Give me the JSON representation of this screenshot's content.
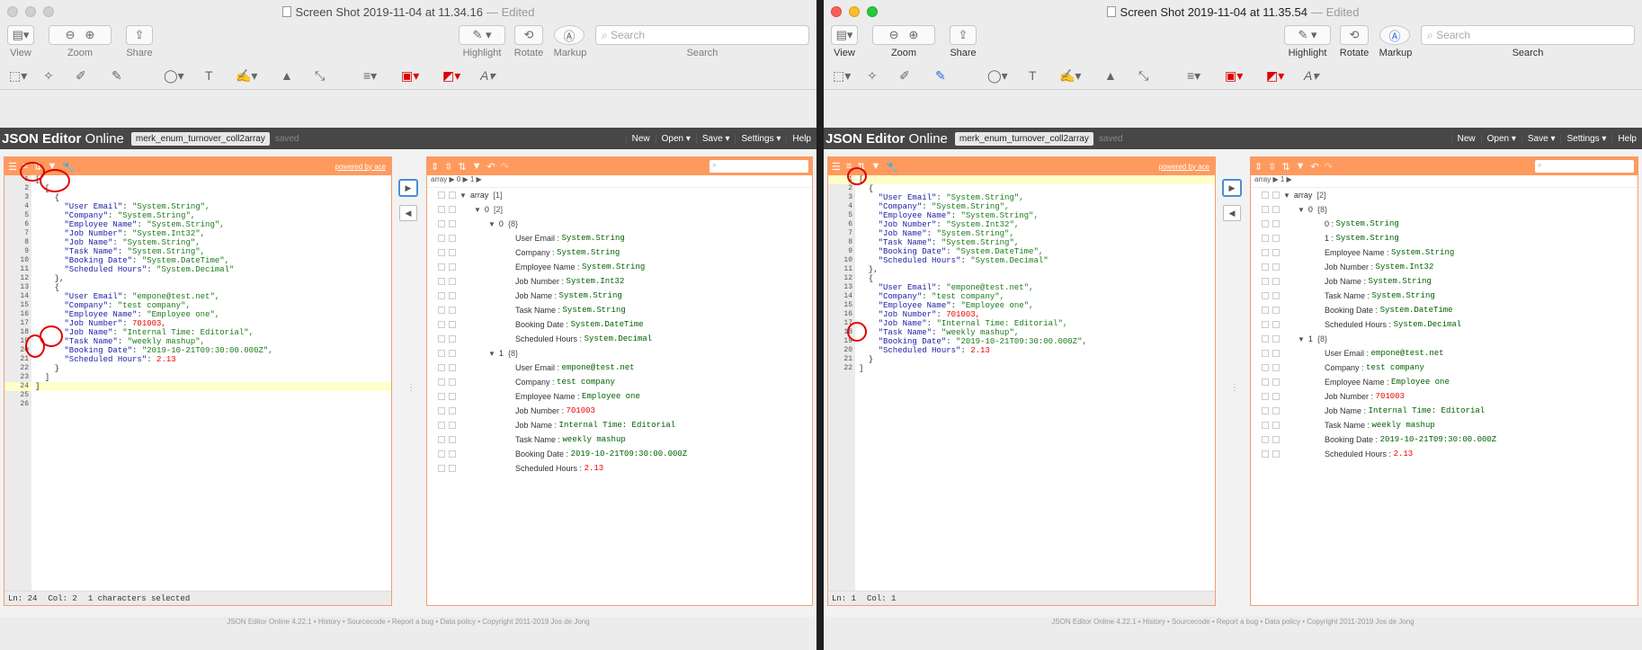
{
  "left": {
    "title": "Screen Shot 2019-11-04 at 11.34.16",
    "edited": "— Edited",
    "toolbar": {
      "view": "View",
      "zoom": "Zoom",
      "share": "Share",
      "highlight": "Highlight",
      "rotate": "Rotate",
      "markup": "Markup",
      "search_placeholder": "Search",
      "search_label": "Search"
    },
    "app": {
      "logo_bold": "JSON Editor",
      "logo_light": " Online",
      "filename": "merk_enum_turnover_coll2array",
      "saved": "saved",
      "menu": [
        "New",
        "Open ▾",
        "Save ▾",
        "Settings ▾",
        "Help"
      ],
      "powered": "powered by ace"
    },
    "code_lines": [
      "[",
      "  [",
      "    {",
      "      \"User Email\": \"System.String\",",
      "      \"Company\": \"System.String\",",
      "      \"Employee Name\": \"System.String\",",
      "      \"Job Number\": \"System.Int32\",",
      "      \"Job Name\": \"System.String\",",
      "      \"Task Name\": \"System.String\",",
      "      \"Booking Date\": \"System.DateTime\",",
      "      \"Scheduled Hours\": \"System.Decimal\"",
      "    },",
      "    {",
      "      \"User Email\": \"empone@test.net\",",
      "      \"Company\": \"test company\",",
      "      \"Employee Name\": \"Employee one\",",
      "      \"Job Number\": 701003,",
      "      \"Job Name\": \"Internal Time: Editorial\",",
      "      \"Task Name\": \"weekly mashup\",",
      "      \"Booking Date\": \"2019-10-21T09:30:00.000Z\",",
      "      \"Scheduled Hours\": 2.13",
      "    }",
      "  ]",
      "]",
      "",
      ""
    ],
    "status": {
      "ln": "Ln: 24",
      "col": "Col: 2",
      "sel": "1 characters selected"
    },
    "crumb": "array ▶ 0 ▶ 1 ▶",
    "tree": [
      {
        "indent": 0,
        "arrow": "▼",
        "key": "array",
        "count": "[1]"
      },
      {
        "indent": 1,
        "arrow": "▼",
        "key": "0",
        "count": "[2]"
      },
      {
        "indent": 2,
        "arrow": "▼",
        "key": "0",
        "count": "{8}"
      },
      {
        "indent": 3,
        "key": "User Email",
        "val": "System.String"
      },
      {
        "indent": 3,
        "key": "Company",
        "val": "System.String"
      },
      {
        "indent": 3,
        "key": "Employee Name",
        "val": "System.String"
      },
      {
        "indent": 3,
        "key": "Job Number",
        "val": "System.Int32"
      },
      {
        "indent": 3,
        "key": "Job Name",
        "val": "System.String"
      },
      {
        "indent": 3,
        "key": "Task Name",
        "val": "System.String"
      },
      {
        "indent": 3,
        "key": "Booking Date",
        "val": "System.DateTime"
      },
      {
        "indent": 3,
        "key": "Scheduled Hours",
        "val": "System.Decimal"
      },
      {
        "indent": 2,
        "arrow": "▼",
        "key": "1",
        "count": "{8}"
      },
      {
        "indent": 3,
        "key": "User Email",
        "val": "empone@test.net"
      },
      {
        "indent": 3,
        "key": "Company",
        "val": "test company"
      },
      {
        "indent": 3,
        "key": "Employee Name",
        "val": "Employee one"
      },
      {
        "indent": 3,
        "key": "Job Number",
        "num": "701003"
      },
      {
        "indent": 3,
        "key": "Job Name",
        "val": "Internal Time: Editorial"
      },
      {
        "indent": 3,
        "key": "Task Name",
        "val": "weekly mashup"
      },
      {
        "indent": 3,
        "key": "Booking Date",
        "val": "2019-10-21T09:30:00.000Z"
      },
      {
        "indent": 3,
        "key": "Scheduled Hours",
        "num": "2.13"
      }
    ],
    "footer": "JSON Editor Online 4.22.1 • History • Sourcecode • Report a bug • Data policy • Copyright 2011-2019 Jos de Jong"
  },
  "right": {
    "title": "Screen Shot 2019-11-04 at 11.35.54",
    "edited": "— Edited",
    "code_lines": [
      "[",
      "  {",
      "    \"User Email\": \"System.String\",",
      "    \"Company\": \"System.String\",",
      "    \"Employee Name\": \"System.String\",",
      "    \"Job Number\": \"System.Int32\",",
      "    \"Job Name\": \"System.String\",",
      "    \"Task Name\": \"System.String\",",
      "    \"Booking Date\": \"System.DateTime\",",
      "    \"Scheduled Hours\": \"System.Decimal\"",
      "  },",
      "  {",
      "    \"User Email\": \"empone@test.net\",",
      "    \"Company\": \"test company\",",
      "    \"Employee Name\": \"Employee one\",",
      "    \"Job Number\": 701003,",
      "    \"Job Name\": \"Internal Time: Editorial\",",
      "    \"Task Name\": \"weekly mashup\",",
      "    \"Booking Date\": \"2019-10-21T09:30:00.000Z\",",
      "    \"Scheduled Hours\": 2.13",
      "  }",
      "]"
    ],
    "status": {
      "ln": "Ln: 1",
      "col": "Col: 1"
    },
    "crumb": "array ▶ 1 ▶",
    "tree": [
      {
        "indent": 0,
        "arrow": "▼",
        "key": "array",
        "count": "[2]"
      },
      {
        "indent": 1,
        "arrow": "▼",
        "key": "0",
        "count": "{8}"
      },
      {
        "indent": 2,
        "key": "0    ",
        "val": "System.String"
      },
      {
        "indent": 2,
        "key": "1    ",
        "val": "System.String"
      },
      {
        "indent": 2,
        "key": "Employee Name",
        "val": "System.String"
      },
      {
        "indent": 2,
        "key": "Job Number",
        "val": "System.Int32"
      },
      {
        "indent": 2,
        "key": "Job Name",
        "val": "System.String"
      },
      {
        "indent": 2,
        "key": "Task Name",
        "val": "System.String"
      },
      {
        "indent": 2,
        "key": "Booking Date",
        "val": "System.DateTime"
      },
      {
        "indent": 2,
        "key": "Scheduled Hours",
        "val": "System.Decimal"
      },
      {
        "indent": 1,
        "arrow": "▼",
        "key": "1",
        "count": "{8}"
      },
      {
        "indent": 2,
        "key": "User Email",
        "val": "empone@test.net"
      },
      {
        "indent": 2,
        "key": "Company",
        "val": "test company"
      },
      {
        "indent": 2,
        "key": "Employee Name",
        "val": "Employee one"
      },
      {
        "indent": 2,
        "key": "Job Number",
        "num": "701003"
      },
      {
        "indent": 2,
        "key": "Job Name",
        "val": "Internal Time: Editorial"
      },
      {
        "indent": 2,
        "key": "Task Name",
        "val": "weekly mashup"
      },
      {
        "indent": 2,
        "key": "Booking Date",
        "val": "2019-10-21T09:30:00.000Z"
      },
      {
        "indent": 2,
        "key": "Scheduled Hours",
        "num": "2.13"
      }
    ]
  }
}
